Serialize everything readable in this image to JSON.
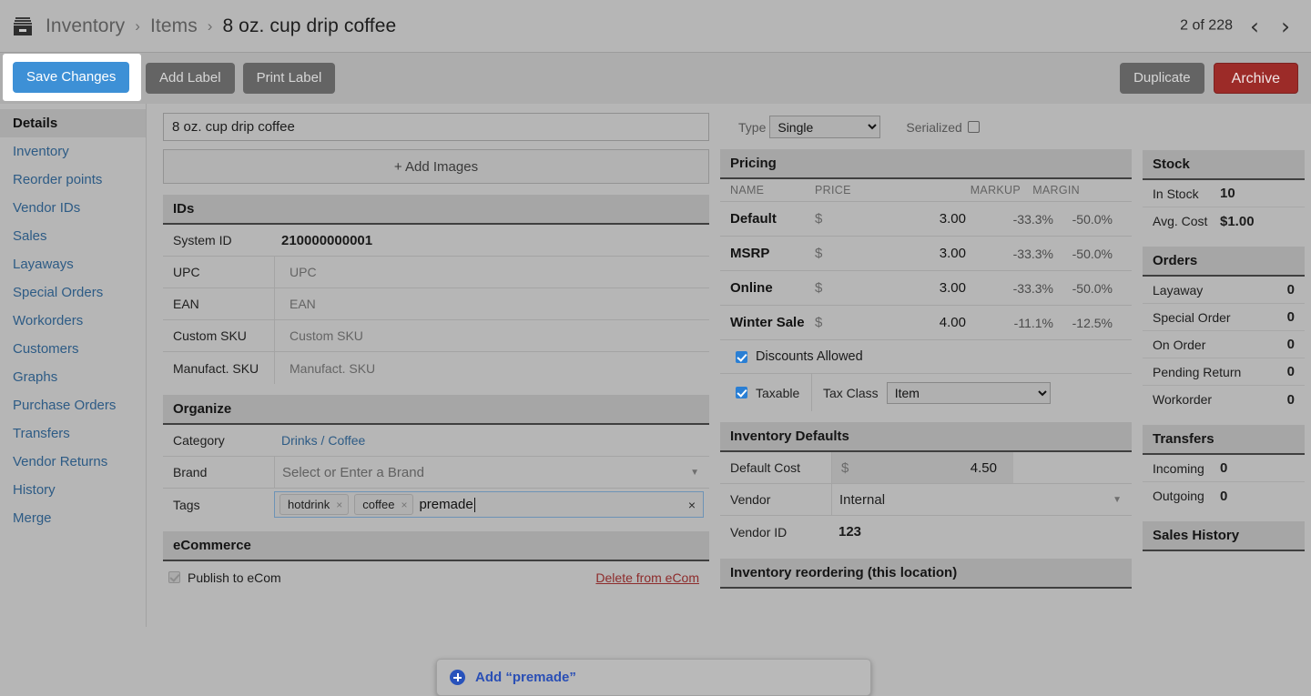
{
  "breadcrumb": {
    "icon": "inventory-box-icon",
    "items": [
      "Inventory",
      "Items",
      "8 oz. cup drip coffee"
    ],
    "separator": "›"
  },
  "pager": {
    "label": "2 of 228",
    "prev_icon": "‹",
    "next_icon": "›"
  },
  "toolbar": {
    "save_label": "Save Changes",
    "add_label": "Add Label",
    "print_label": "Print Label",
    "duplicate_label": "Duplicate",
    "archive_label": "Archive"
  },
  "sidebar": {
    "items": [
      {
        "label": "Details",
        "active": true
      },
      {
        "label": "Inventory",
        "active": false
      },
      {
        "label": "Reorder points",
        "active": false
      },
      {
        "label": "Vendor IDs",
        "active": false
      },
      {
        "label": "Sales",
        "active": false
      },
      {
        "label": "Layaways",
        "active": false
      },
      {
        "label": "Special Orders",
        "active": false
      },
      {
        "label": "Workorders",
        "active": false
      },
      {
        "label": "Customers",
        "active": false
      },
      {
        "label": "Graphs",
        "active": false
      },
      {
        "label": "Purchase Orders",
        "active": false
      },
      {
        "label": "Transfers",
        "active": false
      },
      {
        "label": "Vendor Returns",
        "active": false
      },
      {
        "label": "History",
        "active": false
      },
      {
        "label": "Merge",
        "active": false
      }
    ]
  },
  "item": {
    "title_value": "8 oz. cup drip coffee",
    "type_label": "Type",
    "type_value": "Single",
    "serialized_label": "Serialized",
    "serialized_checked": false,
    "add_images_label": "+ Add Images"
  },
  "ids": {
    "heading": "IDs",
    "rows": [
      {
        "label": "System ID",
        "value": "210000000001",
        "placeholder": false
      },
      {
        "label": "UPC",
        "value": "UPC",
        "placeholder": true
      },
      {
        "label": "EAN",
        "value": "EAN",
        "placeholder": true
      },
      {
        "label": "Custom SKU",
        "value": "Custom SKU",
        "placeholder": true
      },
      {
        "label": "Manufact. SKU",
        "value": "Manufact. SKU",
        "placeholder": true
      }
    ]
  },
  "organize": {
    "heading": "Organize",
    "category_label": "Category",
    "category_value": "Drinks / Coffee",
    "brand_label": "Brand",
    "brand_placeholder": "Select or Enter a Brand",
    "tags_label": "Tags",
    "tags": [
      "hotdrink",
      "coffee"
    ],
    "tag_input_value": "premade",
    "tag_remove_icon": "×",
    "tags_clear_icon": "×",
    "dropdown_label": "Add “premade”"
  },
  "ecommerce": {
    "heading": "eCommerce",
    "publish_label": "Publish to eCom",
    "publish_checked": true,
    "delete_label": "Delete from eCom"
  },
  "pricing": {
    "heading": "Pricing",
    "columns": [
      "NAME",
      "PRICE",
      "MARKUP",
      "MARGIN"
    ],
    "currency": "$",
    "rows": [
      {
        "name": "Default",
        "price": "3.00",
        "markup": "-33.3%",
        "margin": "-50.0%"
      },
      {
        "name": "MSRP",
        "price": "3.00",
        "markup": "-33.3%",
        "margin": "-50.0%"
      },
      {
        "name": "Online",
        "price": "3.00",
        "markup": "-33.3%",
        "margin": "-50.0%"
      },
      {
        "name": "Winter Sale",
        "price": "4.00",
        "markup": "-11.1%",
        "margin": "-12.5%"
      }
    ],
    "discounts_label": "Discounts Allowed",
    "discounts_checked": true,
    "taxable_label": "Taxable",
    "taxable_checked": true,
    "tax_class_label": "Tax Class",
    "tax_class_value": "Item"
  },
  "inventory_defaults": {
    "heading": "Inventory Defaults",
    "default_cost_label": "Default Cost",
    "default_cost_currency": "$",
    "default_cost_value": "4.50",
    "vendor_label": "Vendor",
    "vendor_value": "Internal",
    "vendor_id_label": "Vendor ID",
    "vendor_id_value": "123"
  },
  "reordering": {
    "heading": "Inventory reordering (this location)"
  },
  "stock": {
    "heading": "Stock",
    "rows": [
      {
        "label": "In Stock",
        "value": "10"
      },
      {
        "label": "Avg. Cost",
        "value": "$1.00"
      }
    ]
  },
  "orders": {
    "heading": "Orders",
    "rows": [
      {
        "label": "Layaway",
        "value": "0"
      },
      {
        "label": "Special Order",
        "value": "0"
      },
      {
        "label": "On Order",
        "value": "0"
      },
      {
        "label": "Pending Return",
        "value": "0"
      },
      {
        "label": "Workorder",
        "value": "0"
      }
    ]
  },
  "transfers": {
    "heading": "Transfers",
    "rows": [
      {
        "label": "Incoming",
        "value": "0"
      },
      {
        "label": "Outgoing",
        "value": "0"
      }
    ]
  },
  "sales_history": {
    "heading": "Sales History"
  },
  "colors": {
    "accent_blue": "#3d90d6",
    "link_blue": "#2d5b85",
    "danger_red": "#9c2b28",
    "delete_link_red": "#8d2b2b",
    "page_bg": "#b6b6b6",
    "panel_head": "#a6a6a6"
  }
}
